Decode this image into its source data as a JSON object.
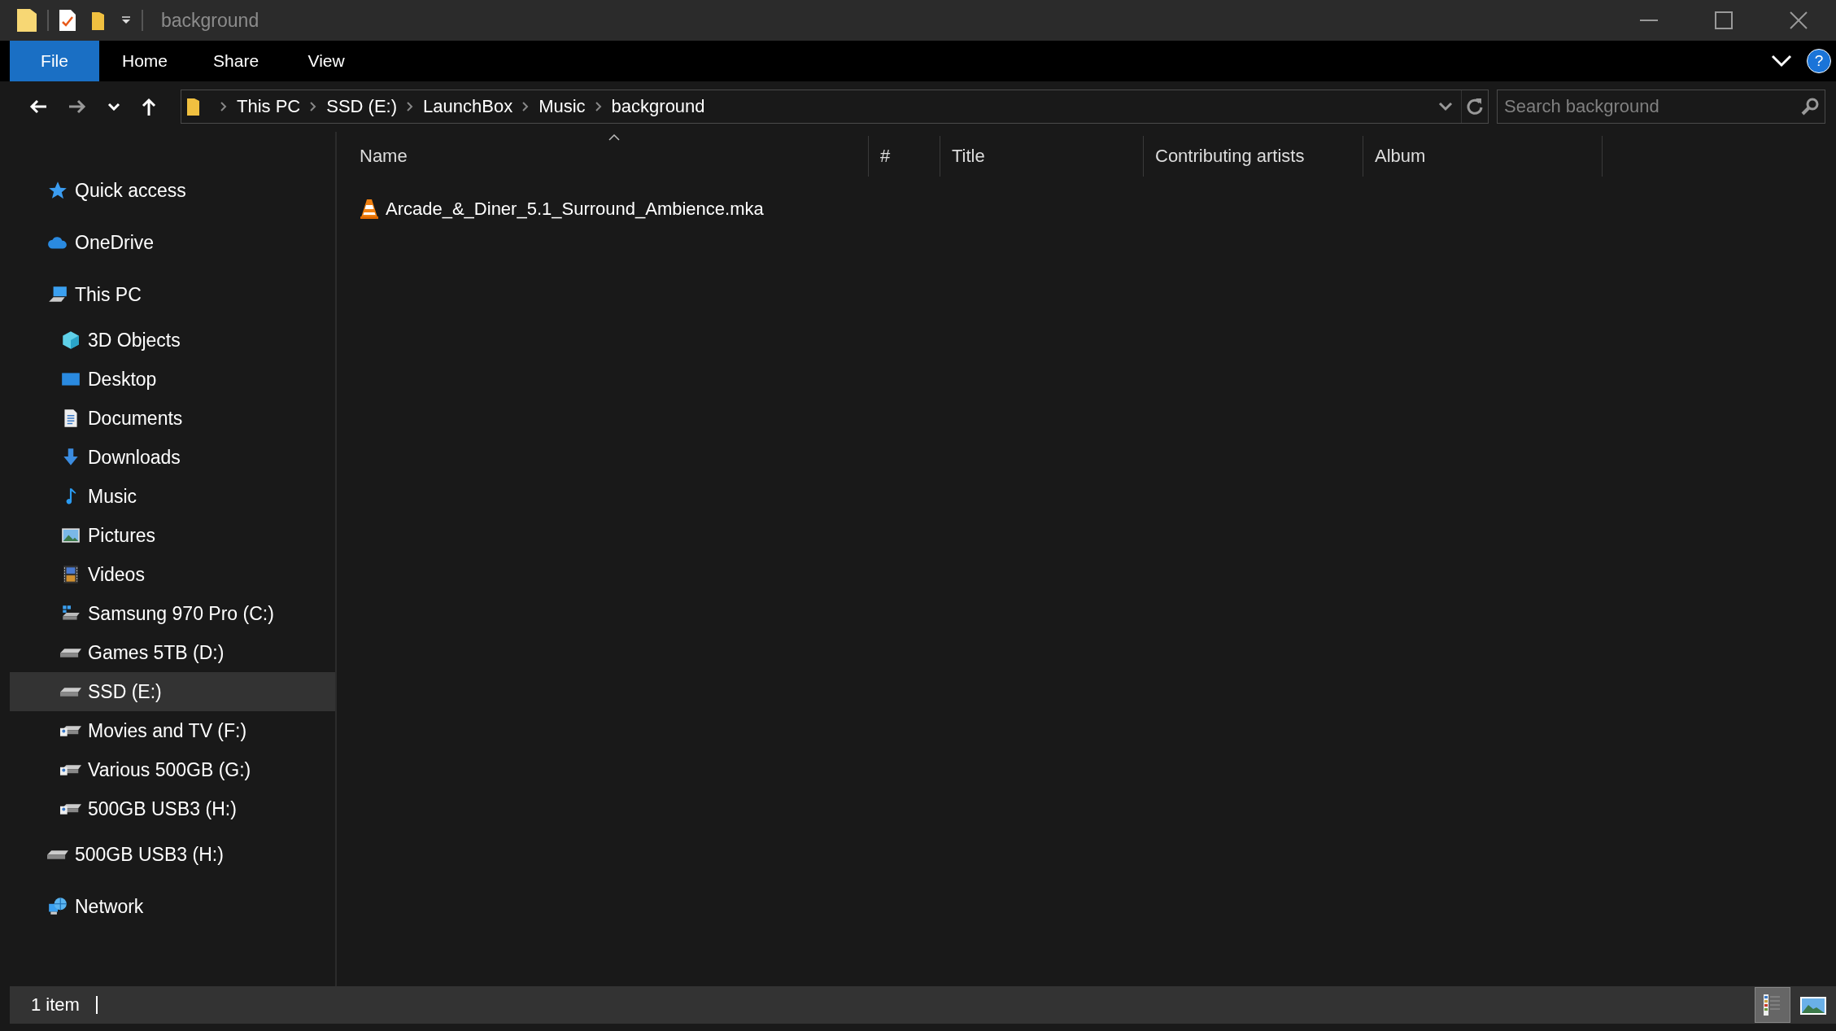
{
  "window": {
    "title": "background"
  },
  "ribbon": {
    "help_button": "?",
    "tabs": [
      {
        "label": "File",
        "selected": true
      },
      {
        "label": "Home",
        "selected": false
      },
      {
        "label": "Share",
        "selected": false
      },
      {
        "label": "View",
        "selected": false
      }
    ]
  },
  "address_bar": {
    "breadcrumbs": [
      "This PC",
      "SSD (E:)",
      "LaunchBox",
      "Music",
      "background"
    ]
  },
  "search": {
    "placeholder": "Search background"
  },
  "nav_pane": {
    "items": [
      {
        "label": "Quick access",
        "kind": "star",
        "selected": false
      },
      {
        "label": "OneDrive",
        "kind": "cloud",
        "selected": false
      },
      {
        "label": "This PC",
        "kind": "pc",
        "selected": false,
        "children": [
          {
            "label": "3D Objects",
            "kind": "cube",
            "selected": false
          },
          {
            "label": "Desktop",
            "kind": "desktop",
            "selected": false
          },
          {
            "label": "Documents",
            "kind": "document",
            "selected": false
          },
          {
            "label": "Downloads",
            "kind": "download",
            "selected": false
          },
          {
            "label": "Music",
            "kind": "music",
            "selected": false
          },
          {
            "label": "Pictures",
            "kind": "pictures",
            "selected": false
          },
          {
            "label": "Videos",
            "kind": "videos",
            "selected": false
          },
          {
            "label": "Samsung 970 Pro (C:)",
            "kind": "system-drive",
            "selected": false
          },
          {
            "label": "Games 5TB (D:)",
            "kind": "drive",
            "selected": false
          },
          {
            "label": "SSD (E:)",
            "kind": "drive",
            "selected": true
          },
          {
            "label": "Movies and TV (F:)",
            "kind": "shared-drive",
            "selected": false
          },
          {
            "label": "Various 500GB (G:)",
            "kind": "shared-drive",
            "selected": false
          },
          {
            "label": "500GB USB3 (H:)",
            "kind": "shared-drive",
            "selected": false
          }
        ]
      },
      {
        "label": "500GB USB3 (H:)",
        "kind": "drive",
        "selected": false
      },
      {
        "label": "Network",
        "kind": "network",
        "selected": false
      }
    ]
  },
  "file_list": {
    "columns": [
      {
        "label": "Name",
        "sorted": true
      },
      {
        "label": "#",
        "sorted": false
      },
      {
        "label": "Title",
        "sorted": false
      },
      {
        "label": "Contributing artists",
        "sorted": false
      },
      {
        "label": "Album",
        "sorted": false
      }
    ],
    "files": [
      {
        "name": "Arcade_&_Diner_5.1_Surround_Ambience.mka"
      }
    ]
  },
  "status_bar": {
    "item_count": "1 item",
    "view_buttons": [
      {
        "kind": "details",
        "selected": true
      },
      {
        "kind": "large-icons",
        "selected": false
      }
    ]
  }
}
